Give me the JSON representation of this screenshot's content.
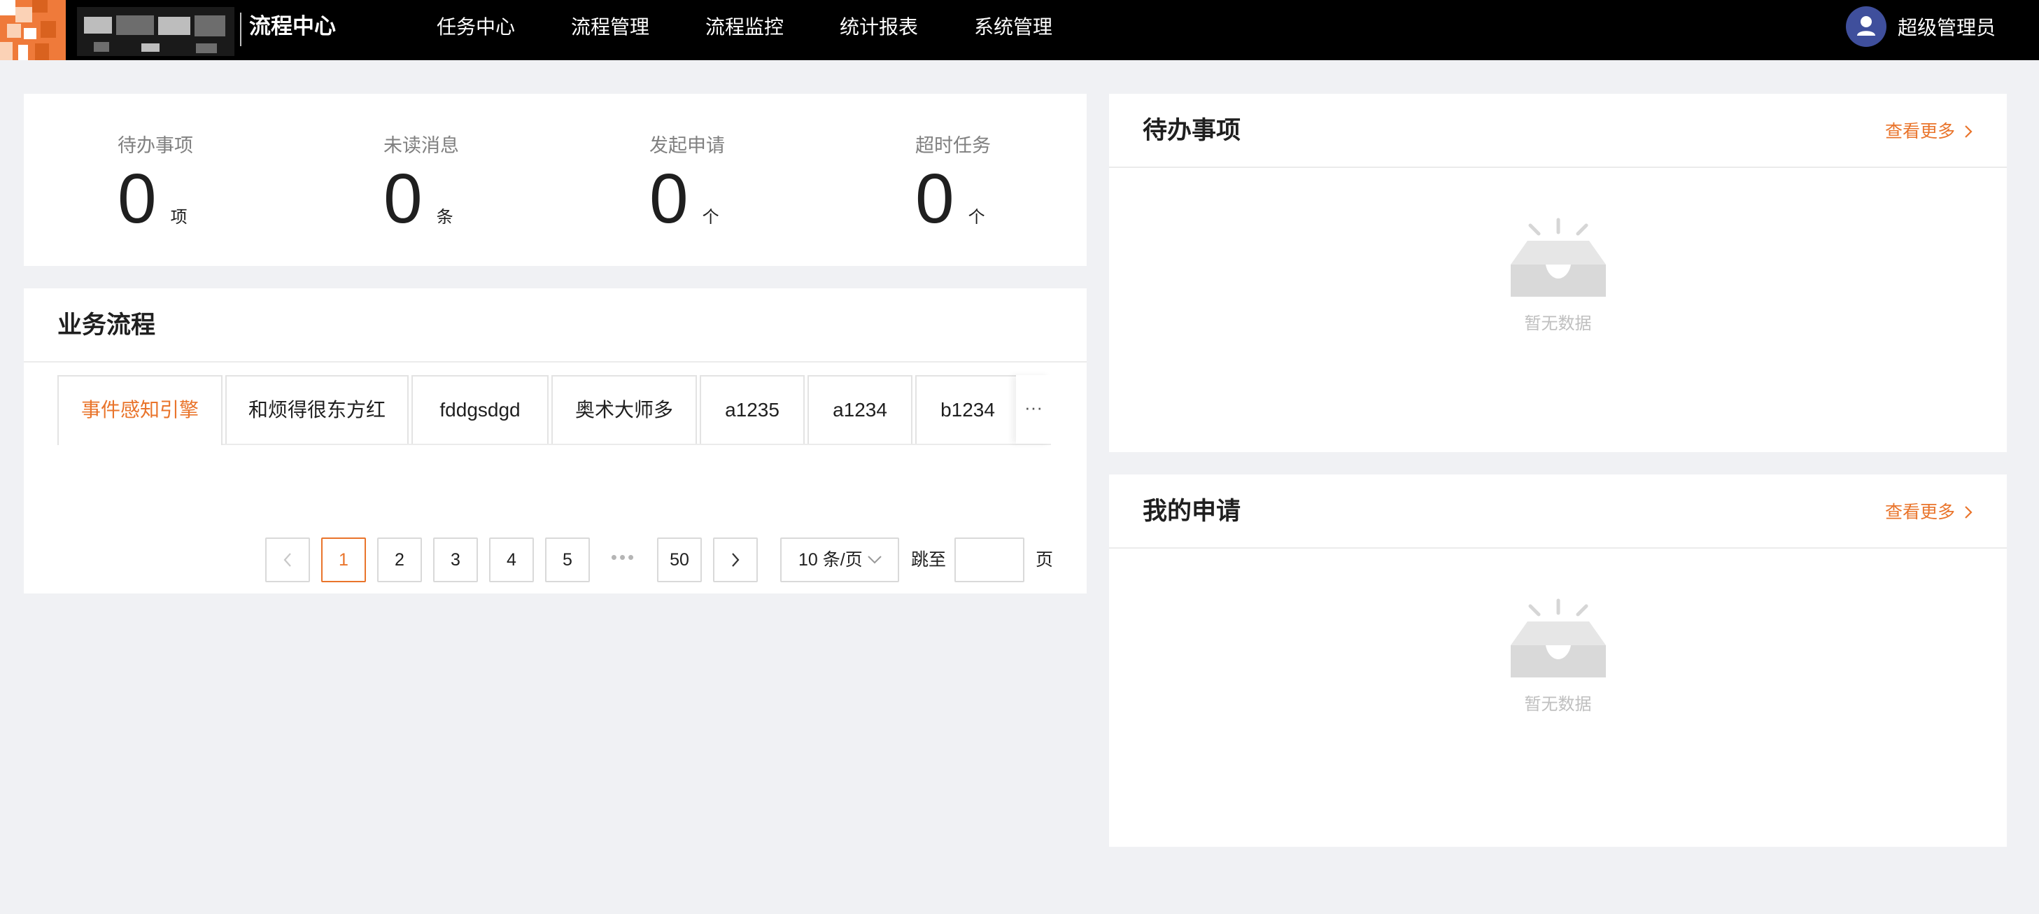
{
  "header": {
    "app_title": "流程中心",
    "nav": [
      "任务中心",
      "流程管理",
      "流程监控",
      "统计报表",
      "系统管理"
    ],
    "user_name": "超级管理员",
    "background": "#000000"
  },
  "stats": [
    {
      "label": "待办事项",
      "value": "0",
      "unit": "项"
    },
    {
      "label": "未读消息",
      "value": "0",
      "unit": "条"
    },
    {
      "label": "发起申请",
      "value": "0",
      "unit": "个"
    },
    {
      "label": "超时任务",
      "value": "0",
      "unit": "个"
    }
  ],
  "business": {
    "title": "业务流程",
    "tabs": [
      "事件感知引擎",
      "和烦得很东方红",
      "fddgsdgd",
      "奥术大师多",
      "a1235",
      "a1234",
      "b1234"
    ],
    "active_tab": "事件感知引擎",
    "more_tabs": "···",
    "pagination": {
      "pages": [
        "1",
        "2",
        "3",
        "4",
        "5"
      ],
      "ellipsis": "•••",
      "last_page": "50",
      "current_page": "1",
      "page_size": "10 条/页",
      "jump_label": "跳至",
      "jump_value": "",
      "page_suffix": "页"
    }
  },
  "todo_panel": {
    "title": "待办事项",
    "more_link": "查看更多",
    "empty_text": "暂无数据"
  },
  "apply_panel": {
    "title": "我的申请",
    "more_link": "查看更多",
    "empty_text": "暂无数据"
  },
  "colors": {
    "accent": "#e9742b",
    "page_background": "#f0f1f4",
    "avatar": "#3f4f9c"
  },
  "icons": [
    "logo-icon",
    "user-avatar-icon",
    "chevron-left-icon",
    "chevron-right-icon",
    "chevron-down-icon",
    "empty-inbox-icon"
  ]
}
